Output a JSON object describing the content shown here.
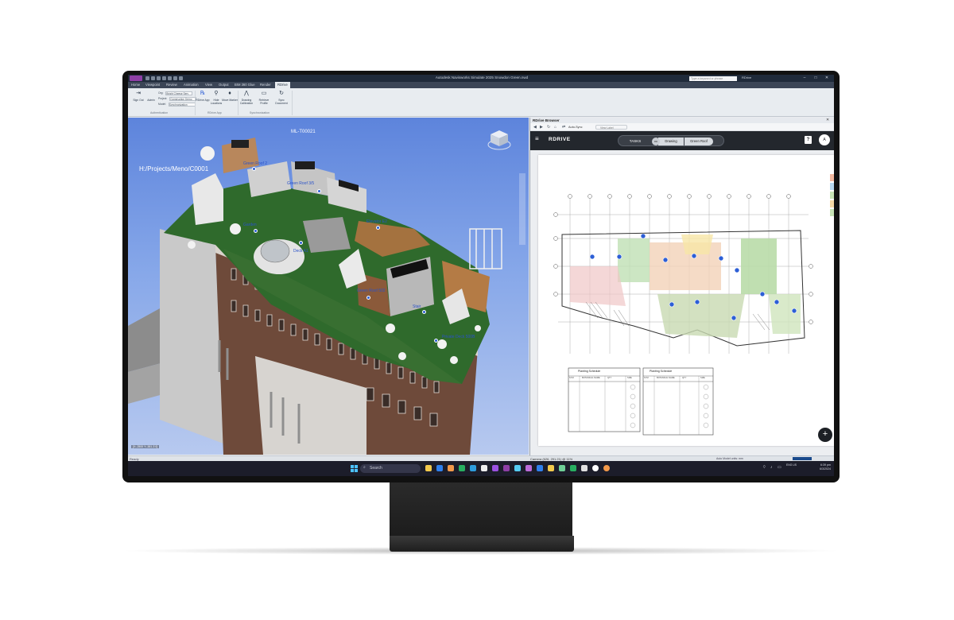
{
  "window": {
    "title": "Autodesk Navisworks Simulate 2025   Snowdon Green.nwd",
    "search_placeholder": "Type a keyword or phrase",
    "user": "RDrive",
    "controls": {
      "minimize": "–",
      "maximize": "□",
      "close": "✕"
    }
  },
  "ribbon": {
    "tabs": [
      "Home",
      "Viewpoint",
      "Review",
      "Animation",
      "View",
      "Output",
      "BIM 360 Glue",
      "Render",
      "RDrive"
    ],
    "active_tab": "RDrive",
    "buttons": {
      "sign_out": "Sign Out",
      "admin": "Admin",
      "rdrive_app": "RDrive App",
      "hide_locations": "Hide Locations",
      "move_marker": "Move Marker",
      "drawing_calibration": "Drawing Calibration",
      "fetch_profile": "Retrieve Profile",
      "sync_document": "Sync Document"
    },
    "fields": {
      "org_label": "Org:",
      "org_value": "Bright Cheese Serv",
      "project_label": "Project:",
      "project_value": "Construction Demo",
      "model_label": "Model:",
      "model_value": "Synchronization"
    },
    "groups": {
      "authentication": "Authentication",
      "rdrive_app": "RDrive App",
      "synchronization": "Synchronization"
    }
  },
  "viewport": {
    "project_path": "H:/Projects/Meno/C0001",
    "view_label": "ML-T00021",
    "coords": "[X:-2500 Y:-381 Z:0]",
    "tags": [
      {
        "label": "Green Roof 2"
      },
      {
        "label": "Elevator E2"
      },
      {
        "label": "Green Roof 3/5"
      },
      {
        "label": "Garden"
      },
      {
        "label": "Green Roof 502"
      },
      {
        "label": "Stair"
      },
      {
        "label": "Private Deck 500B"
      },
      {
        "label": "Deck A1"
      }
    ]
  },
  "rdrive": {
    "window_title": "RDrive Browser",
    "close": "✕",
    "auto_sync": "Auto-Sync",
    "view_label": "View Label",
    "logo": "RDRIVE",
    "tasks": "TASKS",
    "crumb_icon": "RD",
    "crumb_drawing": "Drawing",
    "crumb_name": "Green Roof",
    "help": "?",
    "avatar": "A",
    "add": "+",
    "schedules": [
      {
        "title": "Planting Schedule",
        "headers": [
          "SYM",
          "BOTANICAL NAME",
          "QTY",
          "SIZE"
        ]
      },
      {
        "title": "Planting Schedule",
        "headers": [
          "SYM",
          "BOTANICAL NAME",
          "QTY",
          "SIZE"
        ]
      }
    ],
    "accent_color": "#2d5fd6"
  },
  "status": {
    "left": "Ready",
    "camera": "Camera (626, 291.21) @ 11%",
    "right": "Auto   Model units: mm",
    "lang": "ENG US",
    "time": "6:39 pm",
    "date": "6/3/2024"
  },
  "taskbar": {
    "search_placeholder": "Search"
  }
}
